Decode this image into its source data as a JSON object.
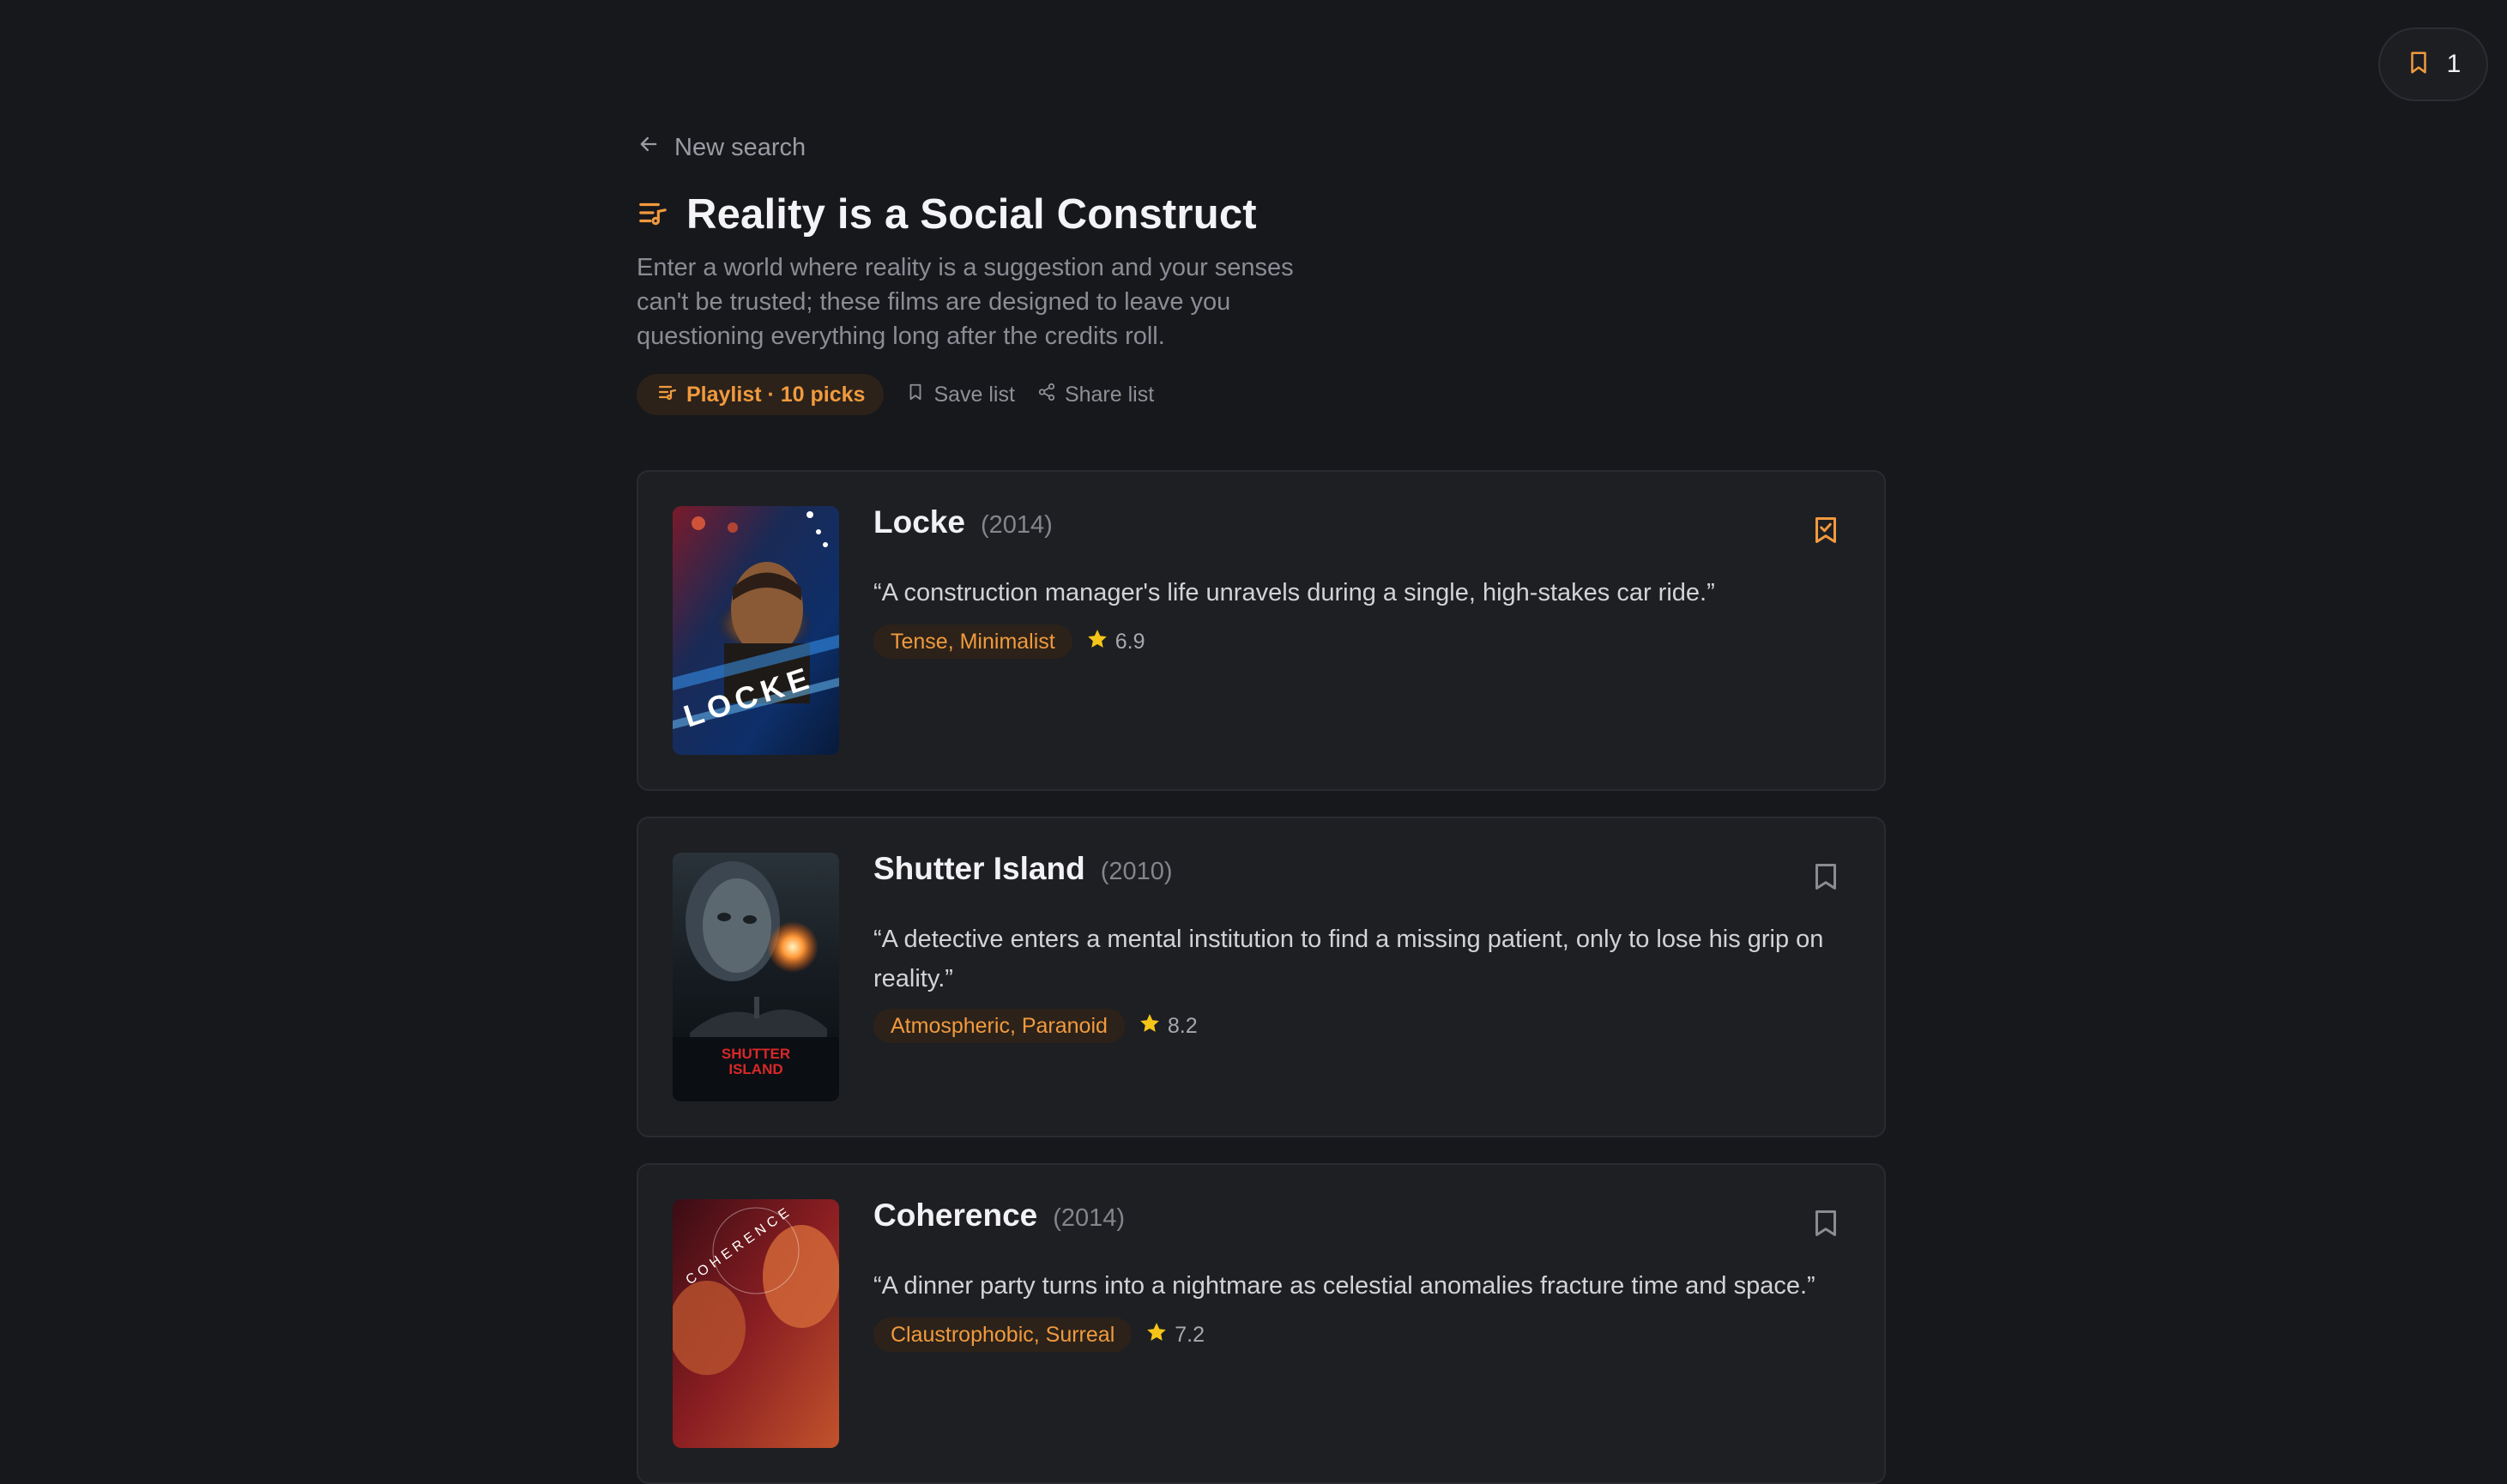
{
  "header": {
    "saved_count": "1",
    "back_label": "New search"
  },
  "playlist": {
    "title": "Reality is a Social Construct",
    "description": "Enter a world where reality is a suggestion and your senses can't be trusted; these films are designed to leave you questioning everything long after the credits roll.",
    "badge": "Playlist · 10 picks",
    "save_label": "Save list",
    "share_label": "Share list"
  },
  "movies": [
    {
      "title": "Locke",
      "year": "(2014)",
      "quote": "“A construction manager's life unravels during a single, high-stakes car ride.”",
      "moods": "Tense, Minimalist",
      "rating": "6.9",
      "saved": true,
      "poster_text": "LOCKE"
    },
    {
      "title": "Shutter Island",
      "year": "(2010)",
      "quote": "“A detective enters a mental institution to find a missing patient, only to lose his grip on reality.”",
      "moods": "Atmospheric, Paranoid",
      "rating": "8.2",
      "saved": false,
      "poster_text": "SHUTTER ISLAND"
    },
    {
      "title": "Coherence",
      "year": "(2014)",
      "quote": "“A dinner party turns into a nightmare as celestial anomalies fracture time and space.”",
      "moods": "Claustrophobic, Surreal",
      "rating": "7.2",
      "saved": false,
      "poster_text": "COHERENCE"
    }
  ],
  "colors": {
    "accent": "#f19a3e",
    "background": "#17181c",
    "card": "#1e1f23",
    "star": "#f5c518"
  },
  "icons": {
    "saved_pill": "bookmark-icon",
    "back": "arrow-left-icon",
    "title": "playlist-icon",
    "save": "bookmark-icon",
    "share": "share-icon",
    "rating": "star-icon",
    "saved": "bookmark-check-icon",
    "unsaved": "bookmark-icon"
  }
}
